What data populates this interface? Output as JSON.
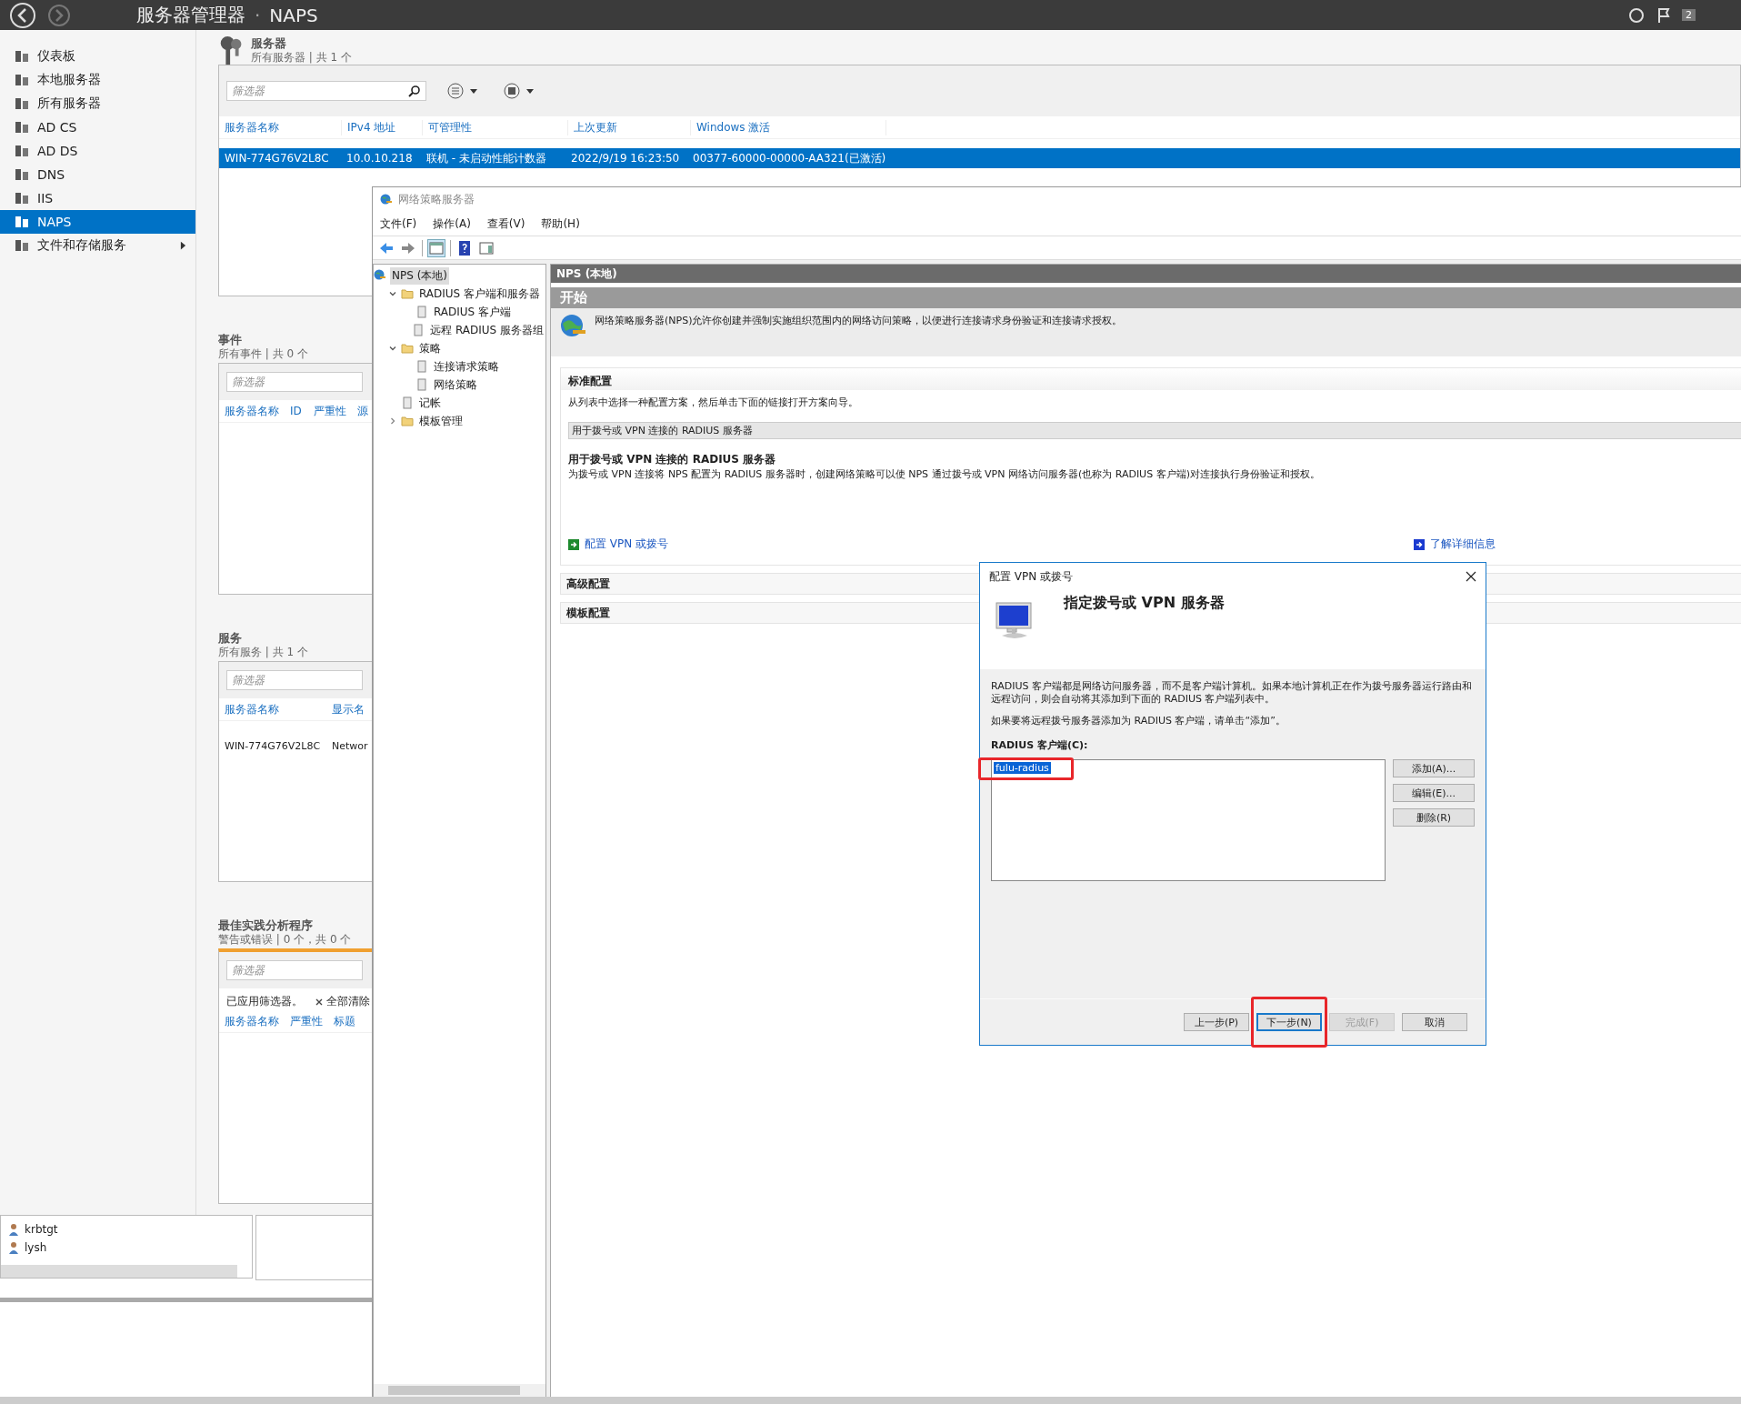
{
  "window": {
    "title": "服务器管理器",
    "separator": "·",
    "page": "NAPS",
    "notification_count": "2"
  },
  "sidebar": {
    "items": [
      {
        "label": "仪表板",
        "selected": false
      },
      {
        "label": "本地服务器",
        "selected": false
      },
      {
        "label": "所有服务器",
        "selected": false
      },
      {
        "label": "AD CS",
        "selected": false
      },
      {
        "label": "AD DS",
        "selected": false
      },
      {
        "label": "DNS",
        "selected": false
      },
      {
        "label": "IIS",
        "selected": false
      },
      {
        "label": "NAPS",
        "selected": true
      },
      {
        "label": "文件和存储服务",
        "selected": false,
        "has_submenu": true
      }
    ]
  },
  "servers": {
    "title": "服务器",
    "subtitle": "所有服务器 | 共 1 个",
    "filter_placeholder": "筛选器",
    "columns": [
      "服务器名称",
      "IPv4 地址",
      "可管理性",
      "上次更新",
      "Windows 激活"
    ],
    "rows": [
      {
        "cells": [
          "WIN-774G76V2L8C",
          "10.0.10.218",
          "联机 - 未启动性能计数器",
          "2022/9/19 16:23:50",
          "00377-60000-00000-AA321(已激活)"
        ],
        "selected": true
      }
    ]
  },
  "events": {
    "title": "事件",
    "subtitle": "所有事件 | 共 0 个",
    "filter_placeholder": "筛选器",
    "columns": [
      "服务器名称",
      "ID",
      "严重性",
      "源"
    ]
  },
  "services": {
    "title": "服务",
    "subtitle": "所有服务 | 共 1 个",
    "filter_placeholder": "筛选器",
    "columns": [
      "服务器名称",
      "显示名"
    ],
    "rows": [
      [
        "WIN-774G76V2L8C",
        "Networ"
      ]
    ]
  },
  "bpa": {
    "title": "最佳实践分析程序",
    "subtitle": "警告或错误 | 0 个，共 0 个",
    "filter_placeholder": "筛选器",
    "filter_notice": "已应用筛选器。",
    "clear_all": "全部清除",
    "columns": [
      "服务器名称",
      "严重性",
      "标题"
    ]
  },
  "users_list": {
    "items": [
      "krbtgt",
      "lysh"
    ]
  },
  "nps": {
    "title": "网络策略服务器",
    "menu": [
      "文件(F)",
      "操作(A)",
      "查看(V)",
      "帮助(H)"
    ],
    "tree": [
      {
        "label": "NPS (本地)",
        "selected": true,
        "children": [
          {
            "label": "RADIUS 客户端和服务器",
            "selected": false,
            "expanded": true,
            "children": [
              {
                "label": "RADIUS 客户端",
                "selected": false
              },
              {
                "label": "远程 RADIUS 服务器组",
                "selected": false
              }
            ]
          },
          {
            "label": "策略",
            "selected": false,
            "expanded": true,
            "children": [
              {
                "label": "连接请求策略",
                "selected": false
              },
              {
                "label": "网络策略",
                "selected": false
              }
            ]
          },
          {
            "label": "记帐",
            "selected": false
          },
          {
            "label": "模板管理",
            "selected": false,
            "expanded": false
          }
        ]
      }
    ],
    "pane_title": "NPS (本地)",
    "section_title": "开始",
    "intro": "网络策略服务器(NPS)允许你创建并强制实施组织范围内的网络访问策略，以便进行连接请求身份验证和连接请求授权。",
    "standard": {
      "title": "标准配置",
      "instruction": "从列表中选择一种配置方案，然后单击下面的链接打开方案向导。",
      "scenario": "用于拨号或 VPN 连接的 RADIUS 服务器",
      "scenario_title": "用于拨号或 VPN 连接的 RADIUS 服务器",
      "scenario_description": "为拨号或 VPN 连接将 NPS 配置为 RADIUS 服务器时，创建网络策略可以使 NPS 通过拨号或 VPN 网络访问服务器(也称为 RADIUS 客户端)对连接执行身份验证和授权。",
      "configure_link": "配置 VPN 或拨号",
      "learn_more_link": "了解详细信息"
    },
    "collapsed_sections": [
      "高级配置",
      "模板配置"
    ]
  },
  "dialog": {
    "title": "配置 VPN 或拨号",
    "heading": "指定拨号或 VPN 服务器",
    "text_1": "RADIUS 客户端都是网络访问服务器，而不是客户端计算机。如果本地计算机正在作为拨号服务器运行路由和远程访问，则会自动将其添加到下面的 RADIUS 客户端列表中。",
    "text_2": "如果要将远程拨号服务器添加为 RADIUS 客户端，请单击“添加”。",
    "list_label": "RADIUS 客户端(C):",
    "clients": [
      {
        "name": "fulu-radius",
        "selected": true,
        "highlighted": true
      }
    ],
    "side_buttons": [
      "添加(A)...",
      "编辑(E)...",
      "删除(R)"
    ],
    "footer_buttons": [
      {
        "label": "上一步(P)",
        "disabled": false,
        "default": false,
        "highlighted": false
      },
      {
        "label": "下一步(N)",
        "disabled": false,
        "default": true,
        "highlighted": true
      },
      {
        "label": "完成(F)",
        "disabled": true,
        "default": false,
        "highlighted": false
      },
      {
        "label": "取消",
        "disabled": false,
        "default": false,
        "highlighted": false
      }
    ]
  }
}
